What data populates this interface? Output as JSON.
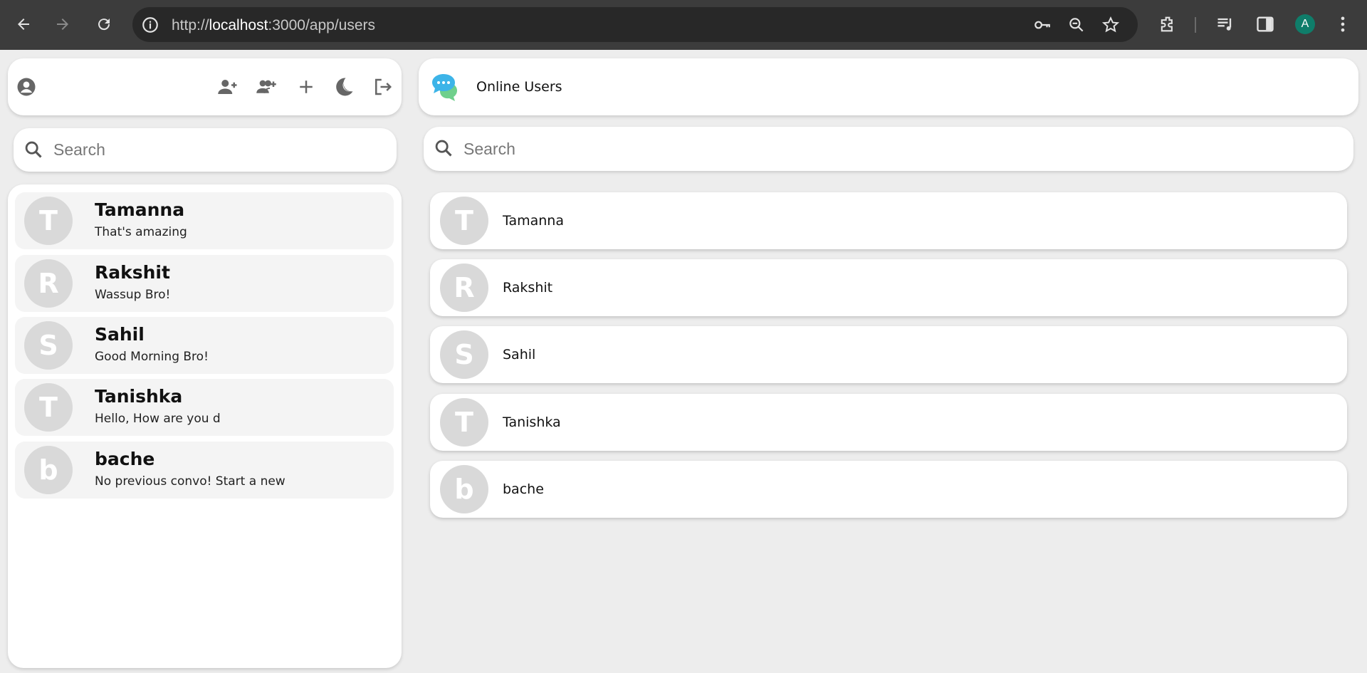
{
  "browser": {
    "url_prefix": "http://",
    "url_host": "localhost",
    "url_path": ":3000/app/users",
    "profile_initial": "A"
  },
  "left": {
    "search_placeholder": "Search",
    "chats": [
      {
        "initial": "T",
        "name": "Tamanna",
        "message": "That's amazing"
      },
      {
        "initial": "R",
        "name": "Rakshit",
        "message": "Wassup Bro!"
      },
      {
        "initial": "S",
        "name": "Sahil",
        "message": "Good Morning Bro!"
      },
      {
        "initial": "T",
        "name": "Tanishka",
        "message": "Hello, How are you d"
      },
      {
        "initial": "b",
        "name": "bache",
        "message": "No previous convo! Start a new"
      }
    ]
  },
  "right": {
    "title": "Online Users",
    "search_placeholder": "Search",
    "users": [
      {
        "initial": "T",
        "name": "Tamanna"
      },
      {
        "initial": "R",
        "name": "Rakshit"
      },
      {
        "initial": "S",
        "name": "Sahil"
      },
      {
        "initial": "T",
        "name": "Tanishka"
      },
      {
        "initial": "b",
        "name": "bache"
      }
    ]
  },
  "colors": {
    "background": "#ededed",
    "chrome": "#3c3c3c",
    "avatar": "#d9d9d9",
    "chat_item_bg": "#f4f4f4",
    "profile": "#0f7d6a"
  }
}
